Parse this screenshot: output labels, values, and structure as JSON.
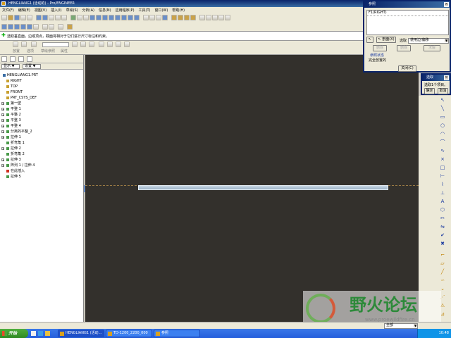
{
  "window": {
    "title": "HENGLIANG1 (活动的) - Pro/ENGINEER"
  },
  "menu": [
    "文件(F)",
    "编辑(E)",
    "视图(V)",
    "插入(I)",
    "草绘(S)",
    "分析(A)",
    "信息(N)",
    "应用程序(P)",
    "工具(T)",
    "窗口(W)",
    "帮助(H)"
  ],
  "message": {
    "text": "选取垂直面，边或顶点，截面将相对于它们进行尺寸标注和约束。"
  },
  "dashboard": {
    "tabs": [
      "放置",
      "选项",
      "草绘参照",
      "属性"
    ]
  },
  "tree": {
    "show_label": "显示 ▼",
    "settings_label": "设置 ▼",
    "items": [
      {
        "label": "HENGLIANG1.PRT",
        "indent": 0,
        "expand": "",
        "icon": "part"
      },
      {
        "label": "RIGHT",
        "indent": 1,
        "expand": "",
        "icon": "datum"
      },
      {
        "label": "TOP",
        "indent": 1,
        "expand": "",
        "icon": "datum"
      },
      {
        "label": "FRONT",
        "indent": 1,
        "expand": "",
        "icon": "datum"
      },
      {
        "label": "PRT_CSYS_DEF",
        "indent": 1,
        "expand": "",
        "icon": "datum"
      },
      {
        "label": "第一壁",
        "indent": 1,
        "expand": "+",
        "icon": "feature"
      },
      {
        "label": "平整 1",
        "indent": 1,
        "expand": "+",
        "icon": "feature"
      },
      {
        "label": "平整 2",
        "indent": 1,
        "expand": "+",
        "icon": "feature"
      },
      {
        "label": "平整 3",
        "indent": 1,
        "expand": "+",
        "icon": "feature"
      },
      {
        "label": "平整 4",
        "indent": 1,
        "expand": "+",
        "icon": "feature"
      },
      {
        "label": "分离的平整_2",
        "indent": 1,
        "expand": "+",
        "icon": "feature"
      },
      {
        "label": "拉伸 1",
        "indent": 1,
        "expand": "+",
        "icon": "feature"
      },
      {
        "label": "折弯角 1",
        "indent": 1,
        "expand": "",
        "icon": "feature"
      },
      {
        "label": "拉伸 2",
        "indent": 1,
        "expand": "+",
        "icon": "feature"
      },
      {
        "label": "折弯角 2",
        "indent": 1,
        "expand": "",
        "icon": "feature"
      },
      {
        "label": "拉伸 3",
        "indent": 1,
        "expand": "+",
        "icon": "feature"
      },
      {
        "label": "阵列 1 / 拉伸 4",
        "indent": 1,
        "expand": "+",
        "icon": "feature"
      },
      {
        "label": "在此插入",
        "indent": 1,
        "expand": "",
        "icon": "insert"
      },
      {
        "label": "拉伸 5",
        "indent": 1,
        "expand": "",
        "icon": "feature"
      }
    ]
  },
  "refs_dialog": {
    "title": "参照",
    "list_item": "F1(RIGHT)",
    "select_label": "选取",
    "dropdown_value": "使用边/偏移",
    "link1": "参照状态",
    "link2": "完全放置的",
    "close_label": "关闭(C)",
    "disabled_buttons": [
      "删除",
      "删除",
      "求解"
    ]
  },
  "select_dialog": {
    "title": "选取",
    "text": "选取1个项目。",
    "ok_label": "确定",
    "cancel_label": "取消"
  },
  "statusbar": {
    "filter_label": "全部"
  },
  "watermark": {
    "name": "野火论坛",
    "url": "www.proewildfire.cn"
  },
  "taskbar": {
    "start_label": "开始",
    "tasks": [
      "HENGLIANG1 (活动...",
      "TD-1200_2200_000",
      "参照"
    ],
    "clock": "10:48"
  }
}
